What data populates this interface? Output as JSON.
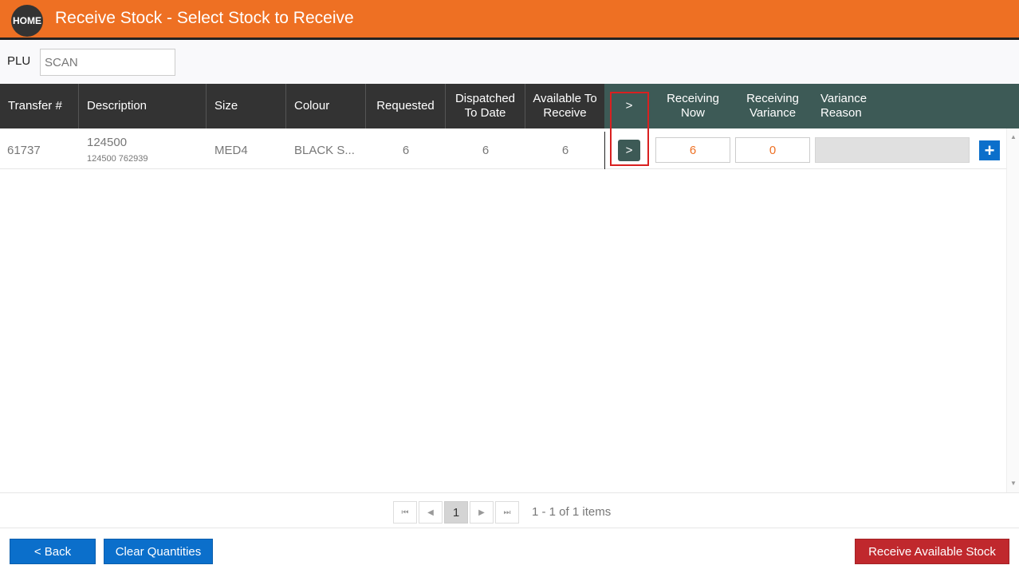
{
  "header": {
    "home_label": "HOME",
    "title": "Receive Stock - Select Stock to Receive"
  },
  "plu": {
    "label": "PLU",
    "placeholder": "SCAN",
    "value": ""
  },
  "columns": {
    "transfer": "Transfer #",
    "description": "Description",
    "size": "Size",
    "colour": "Colour",
    "requested": "Requested",
    "dispatched_line1": "Dispatched",
    "dispatched_line2": "To Date",
    "available_line1": "Available To",
    "available_line2": "Receive",
    "go": ">",
    "receiving_now_line1": "Receiving",
    "receiving_now_line2": "Now",
    "receiving_variance_line1": "Receiving",
    "receiving_variance_line2": "Variance",
    "variance_reason_line1": "Variance",
    "variance_reason_line2": "Reason"
  },
  "rows": [
    {
      "transfer": "61737",
      "description": "124500",
      "description_sub": "124500 762939",
      "size": "MED4",
      "colour": "BLACK S...",
      "requested": "6",
      "dispatched": "6",
      "available": "6",
      "go_label": ">",
      "receiving_now": "6",
      "receiving_variance": "0",
      "variance_reason": "",
      "add_label": "+"
    }
  ],
  "pager": {
    "first": "⏮",
    "prev": "◀",
    "current_page": "1",
    "next": "▶",
    "last": "⏭",
    "info": "1 - 1 of 1 items"
  },
  "footer": {
    "back_label": "< Back",
    "clear_label": "Clear Quantities",
    "receive_label": "Receive Available Stock"
  },
  "colors": {
    "header": "#ee7023",
    "grid_header_dark": "#333333",
    "grid_header_teal": "#3d5a56",
    "primary_button": "#0b6fcb",
    "danger_button": "#c0282d",
    "highlight": "#d92020"
  }
}
